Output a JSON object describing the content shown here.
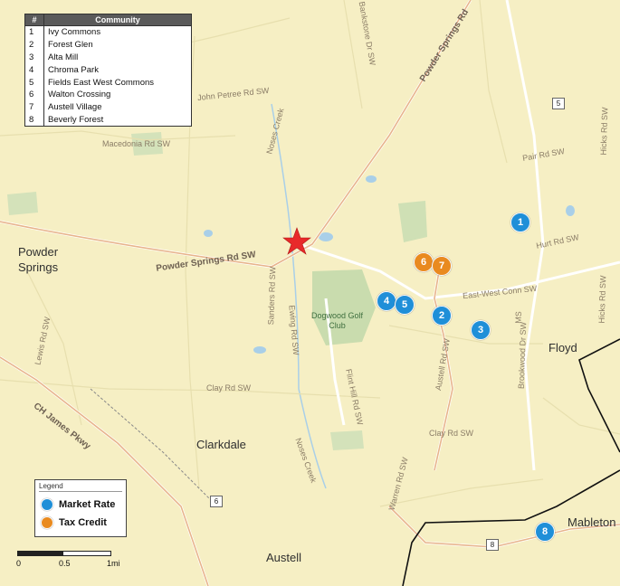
{
  "colors": {
    "market_rate": "#1f8fd8",
    "tax_credit": "#e98a1f",
    "subject_site": "#e8292a",
    "county_line": "#111111"
  },
  "table": {
    "header_num": "#",
    "header_name": "Community",
    "rows": [
      {
        "num": "1",
        "name": "Ivy Commons"
      },
      {
        "num": "2",
        "name": "Forest Glen"
      },
      {
        "num": "3",
        "name": "Alta Mill"
      },
      {
        "num": "4",
        "name": "Chroma Park"
      },
      {
        "num": "5",
        "name": "Fields East West Commons"
      },
      {
        "num": "6",
        "name": "Walton Crossing"
      },
      {
        "num": "7",
        "name": "Austell Village"
      },
      {
        "num": "8",
        "name": "Beverly Forest"
      }
    ]
  },
  "markers": [
    {
      "label": "1",
      "type": "market_rate"
    },
    {
      "label": "2",
      "type": "market_rate"
    },
    {
      "label": "3",
      "type": "market_rate"
    },
    {
      "label": "4",
      "type": "market_rate"
    },
    {
      "label": "5",
      "type": "market_rate"
    },
    {
      "label": "6",
      "type": "tax_credit"
    },
    {
      "label": "7",
      "type": "tax_credit"
    },
    {
      "label": "8",
      "type": "market_rate"
    }
  ],
  "places": {
    "powder_springs_1": "Powder",
    "powder_springs_2": "Springs",
    "clarkdale": "Clarkdale",
    "austell": "Austell",
    "floyd": "Floyd",
    "mableton": "Mableton",
    "golf_1": "Dogwood Golf",
    "golf_2": "Club"
  },
  "roads": {
    "powder_springs_rd": "Powder Springs Rd SW",
    "powder_springs_rd_ne": "Powder Springs Rd",
    "macedonia": "Macedonia Rd SW",
    "john_petree": "John Petree Rd SW",
    "noses_creek_n": "Noses Creek",
    "noses_creek_s": "Noses Creek",
    "hurt": "Hurt Rd SW",
    "east_west": "East-West Conn SW",
    "clay": "Clay Rd SW",
    "clay_e": "Clay Rd SW",
    "ewing": "Ewing Rd SW",
    "flint_hill": "Flint Hill Rd SW",
    "austell_rd": "Austell Rd SW",
    "brookwood": "Brookwood Dr SW",
    "hicks_n": "Hicks Rd SW",
    "hicks_s": "Hicks Rd SW",
    "ch_james": "CH James Pkwy",
    "lewis": "Lewis Rd SW",
    "sanders": "Sanders Rd SW",
    "pair": "Pair Rd SW",
    "bankstone": "Bankstone Dr SW",
    "warren": "Warren Rd SW",
    "ms": "MS",
    "shield_5": "5",
    "shield_6": "6",
    "shield_8": "8"
  },
  "legend": {
    "title": "Legend",
    "market_rate": "Market Rate",
    "tax_credit": "Tax Credit"
  },
  "scale": {
    "t0": "0",
    "t1": "0.5",
    "t2": "1mi"
  }
}
